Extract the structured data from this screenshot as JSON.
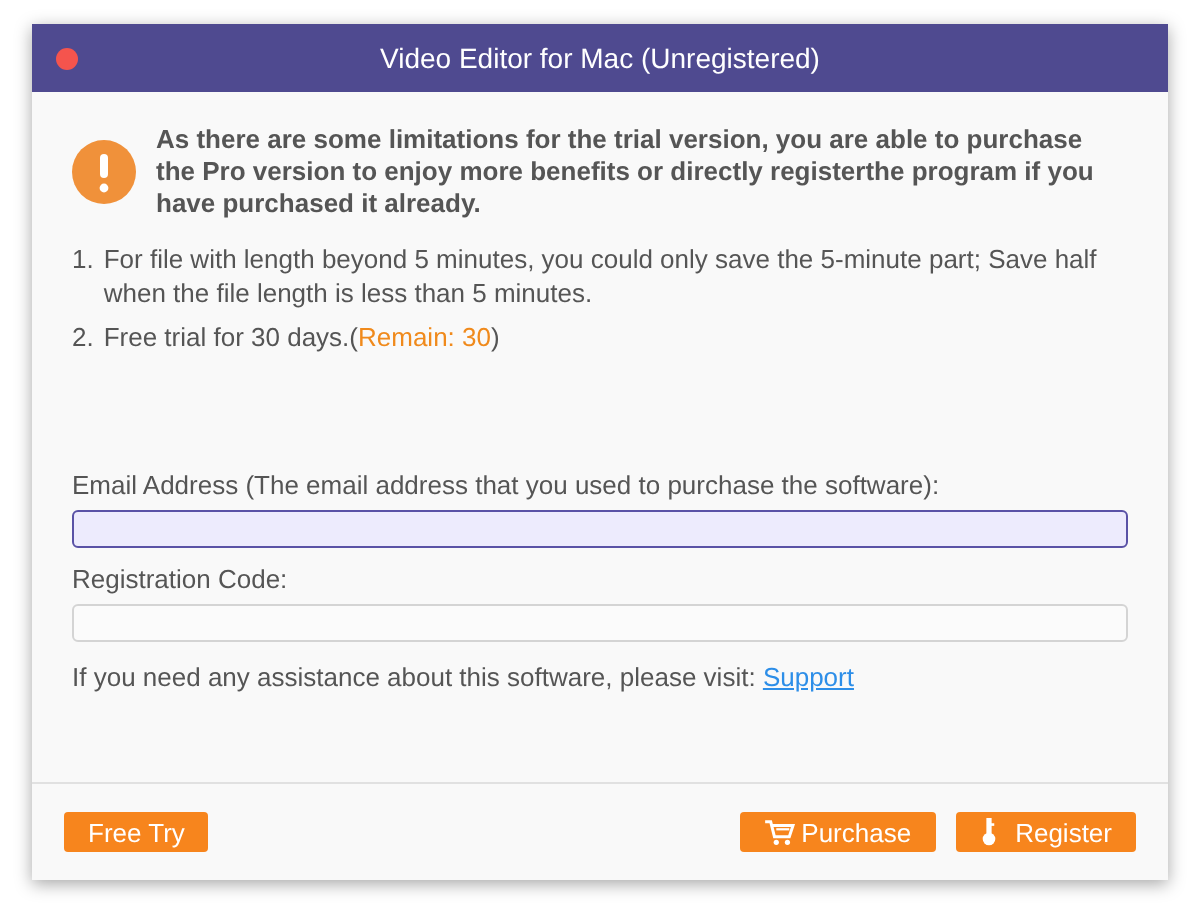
{
  "window": {
    "title": "Video Editor for Mac (Unregistered)"
  },
  "notice": "As there are some limitations for the trial version, you are able to purchase the Pro version to enjoy more benefits or directly registerthe program if you have purchased it already.",
  "limits": [
    {
      "number": "1.",
      "text": "For file with length beyond 5 minutes, you could only save the 5-minute part; Save half when the file length is less than 5 minutes."
    },
    {
      "number": "2.",
      "text": "Free trial for 30 days.(",
      "highlight": "Remain: 30",
      "after": ")"
    }
  ],
  "fields": [
    {
      "label": "Email Address (The email address that you used to purchase the software):",
      "focused": true
    },
    {
      "label": "Registration Code:",
      "focused": false
    }
  ],
  "help": {
    "text": "If you need any assistance about this software, please visit:",
    "link": "Support"
  },
  "buttons": [
    {
      "label": "Free Try",
      "kind": "plain"
    },
    {
      "label": "Purchase",
      "kind": "cart"
    },
    {
      "label": "Register",
      "kind": "key"
    }
  ]
}
